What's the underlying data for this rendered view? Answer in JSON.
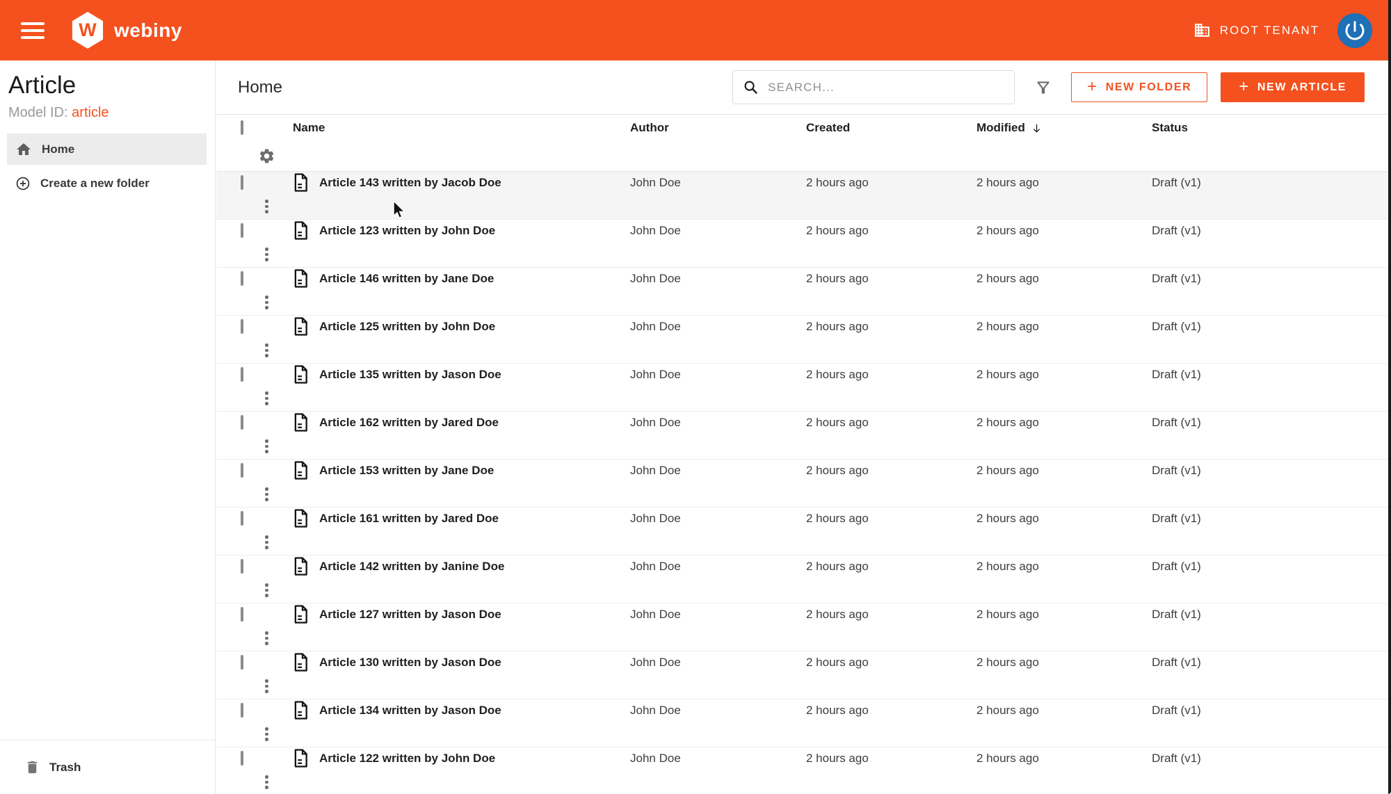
{
  "topbar": {
    "brand": "webiny",
    "logo_letter": "W",
    "tenant_label": "ROOT TENANT"
  },
  "sidebar": {
    "title": "Article",
    "model_id_label": "Model ID:",
    "model_id_value": "article",
    "items": [
      {
        "label": "Home",
        "selected": true
      },
      {
        "label": "Create a new folder",
        "selected": false
      }
    ],
    "trash_label": "Trash"
  },
  "toolbar": {
    "breadcrumb": "Home",
    "search_placeholder": "SEARCH...",
    "new_folder_label": "NEW FOLDER",
    "new_article_label": "NEW ARTICLE"
  },
  "table": {
    "columns": [
      "Name",
      "Author",
      "Created",
      "Modified",
      "Status"
    ],
    "sort": {
      "column": "Modified",
      "direction": "desc"
    },
    "rows": [
      {
        "name": "Article 143 written by Jacob Doe",
        "author": "John Doe",
        "created": "2 hours ago",
        "modified": "2 hours ago",
        "status": "Draft (v1)",
        "hovered": true
      },
      {
        "name": "Article 123 written by John Doe",
        "author": "John Doe",
        "created": "2 hours ago",
        "modified": "2 hours ago",
        "status": "Draft (v1)",
        "hovered": false
      },
      {
        "name": "Article 146 written by Jane Doe",
        "author": "John Doe",
        "created": "2 hours ago",
        "modified": "2 hours ago",
        "status": "Draft (v1)",
        "hovered": false
      },
      {
        "name": "Article 125 written by John Doe",
        "author": "John Doe",
        "created": "2 hours ago",
        "modified": "2 hours ago",
        "status": "Draft (v1)",
        "hovered": false
      },
      {
        "name": "Article 135 written by Jason Doe",
        "author": "John Doe",
        "created": "2 hours ago",
        "modified": "2 hours ago",
        "status": "Draft (v1)",
        "hovered": false
      },
      {
        "name": "Article 162 written by Jared Doe",
        "author": "John Doe",
        "created": "2 hours ago",
        "modified": "2 hours ago",
        "status": "Draft (v1)",
        "hovered": false
      },
      {
        "name": "Article 153 written by Jane Doe",
        "author": "John Doe",
        "created": "2 hours ago",
        "modified": "2 hours ago",
        "status": "Draft (v1)",
        "hovered": false
      },
      {
        "name": "Article 161 written by Jared Doe",
        "author": "John Doe",
        "created": "2 hours ago",
        "modified": "2 hours ago",
        "status": "Draft (v1)",
        "hovered": false
      },
      {
        "name": "Article 142 written by Janine Doe",
        "author": "John Doe",
        "created": "2 hours ago",
        "modified": "2 hours ago",
        "status": "Draft (v1)",
        "hovered": false
      },
      {
        "name": "Article 127 written by Jason Doe",
        "author": "John Doe",
        "created": "2 hours ago",
        "modified": "2 hours ago",
        "status": "Draft (v1)",
        "hovered": false
      },
      {
        "name": "Article 130 written by Jason Doe",
        "author": "John Doe",
        "created": "2 hours ago",
        "modified": "2 hours ago",
        "status": "Draft (v1)",
        "hovered": false
      },
      {
        "name": "Article 134 written by Jason Doe",
        "author": "John Doe",
        "created": "2 hours ago",
        "modified": "2 hours ago",
        "status": "Draft (v1)",
        "hovered": false
      },
      {
        "name": "Article 122 written by John Doe",
        "author": "John Doe",
        "created": "2 hours ago",
        "modified": "2 hours ago",
        "status": "Draft (v1)",
        "hovered": false
      }
    ]
  },
  "icons": {
    "menu": "hamburger",
    "tenant": "building",
    "avatar": "power-symbol",
    "home": "house",
    "create_folder": "circled-plus",
    "trash": "trash-can",
    "search": "magnifier",
    "filter": "funnel",
    "sort": "arrow-down",
    "row_type": "document",
    "table_settings": "gear",
    "row_menu": "kebab-dots"
  },
  "colors": {
    "primary": "#f4511e",
    "topbar_bg": "#f4511e",
    "avatar_bg": "#1e70b7",
    "selected_item_bg": "#ececec",
    "hover_row_bg": "#f5f5f5"
  }
}
